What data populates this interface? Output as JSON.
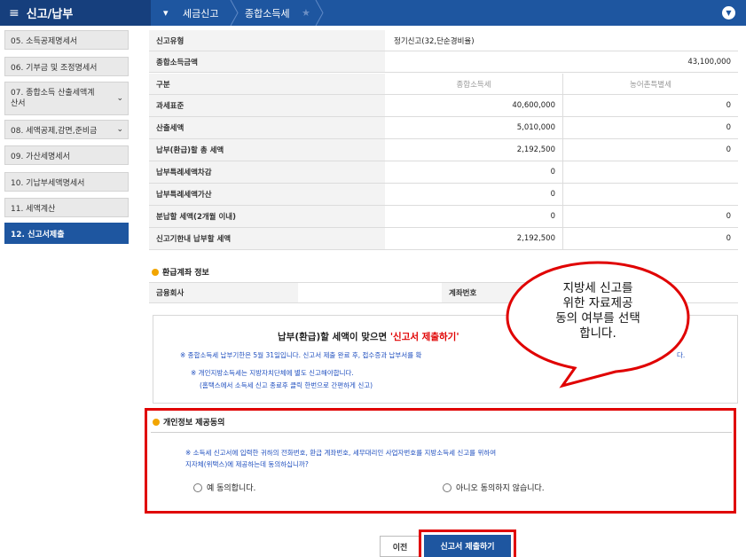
{
  "topbar": {
    "app_title": "신고/납부",
    "crumb1": "세금신고",
    "crumb2": "종합소득세",
    "star_icon": "★"
  },
  "sidebar": {
    "items": [
      {
        "label": "05. 소득공제명세서"
      },
      {
        "label": "06. 기부금 및 조정명세서"
      },
      {
        "label": "07. 종합소득 산출세액계산서",
        "line1": "07. 종합소득 산출세액계",
        "line2": "산서"
      },
      {
        "label": "08. 세액공제,감면,준비금"
      },
      {
        "label": "09. 가산세명세서"
      },
      {
        "label": "10. 기납부세액명세서"
      },
      {
        "label": "11. 세액계산"
      },
      {
        "label": "12. 신고서제출"
      }
    ]
  },
  "summary": {
    "rows": [
      {
        "label": "신고유형",
        "value": "정기신고(32,단순경비율)"
      },
      {
        "label": "종합소득금액",
        "value": "43,100,000"
      }
    ],
    "columns": {
      "label": "구분",
      "col1": "종합소득세",
      "col2": "농어촌특별세"
    },
    "tax_rows": [
      {
        "label": "과세표준",
        "v1": "40,600,000",
        "v2": "0"
      },
      {
        "label": "산출세액",
        "v1": "5,010,000",
        "v2": "0"
      },
      {
        "label": "납부(환급)할 총 세액",
        "v1": "2,192,500",
        "v2": "0"
      },
      {
        "label": "납부특례세액차감",
        "v1": "0",
        "v2": ""
      },
      {
        "label": "납부특례세액가산",
        "v1": "0",
        "v2": ""
      },
      {
        "label": "분납할 세액(2개월 이내)",
        "v1": "0",
        "v2": "0"
      },
      {
        "label": "신고기한내 납부할 세액",
        "v1": "2,192,500",
        "v2": "0"
      }
    ]
  },
  "refund": {
    "title": "환급계좌 정보",
    "bank_label": "금융회사",
    "account_label": "계좌번호"
  },
  "notice": {
    "headline_prefix": "납부(환급)할 세액이 맞으면 ",
    "headline_highlight": "'신고서 제출하기'",
    "line1_a": "※ 종합소득세 납부기한은 5월 31일입니다. 신고서 제출 완료 후, 접수증과 납부서를 확",
    "line1_b": "다.",
    "line2": "※ 개인지방소득세는 지방자치단체에 별도 신고해야합니다.",
    "line3": "(홈택스에서 소득세 신고 종료후 클릭 한번으로 간편하게 신고)"
  },
  "balloon": {
    "line1": "지방세 신고를",
    "line2": "위한 자료제공",
    "line3": "동의 여부를 선택",
    "line4": "합니다."
  },
  "consent": {
    "title": "개인정보 제공동의",
    "text1": "※ 소득세 신고서에 입력한 귀하의 전화번호, 환급 계좌번호, 세무대리인 사업자번호를 지방소득세 신고를 위하여",
    "text2": "지자체(위택스)에 제공하는데 동의하십니까?",
    "agree": "예 동의합니다.",
    "disagree": "아니오 동의하지 않습니다."
  },
  "buttons": {
    "prev": "이전",
    "submit": "신고서 제출하기"
  },
  "colors": {
    "primary": "#1e56a0",
    "highlight_red": "#e00000",
    "notice_blue": "#1f4fbf",
    "bullet": "#f2a500"
  }
}
